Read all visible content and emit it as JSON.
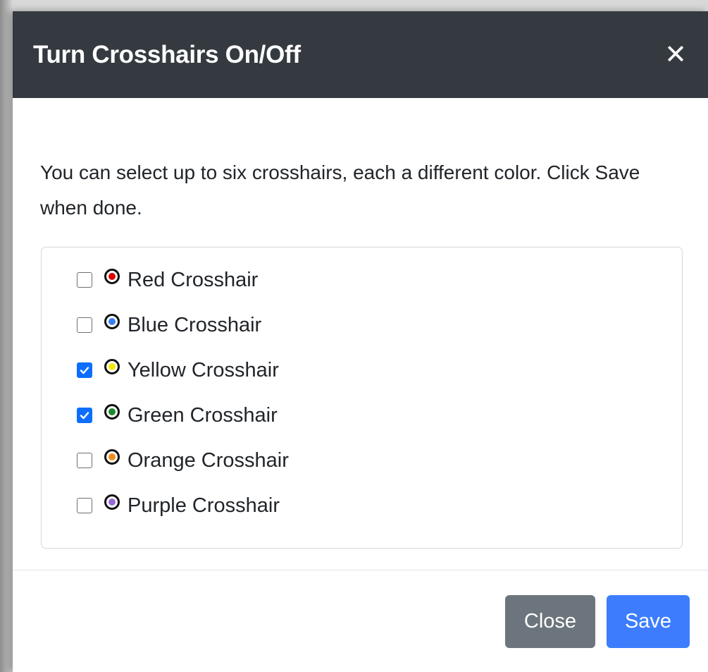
{
  "dialog": {
    "title": "Turn Crosshairs On/Off",
    "close_icon": "close-icon",
    "instructions": "You can select up to six crosshairs, each a different color. Click Save when done."
  },
  "options": [
    {
      "label": "Red Crosshair",
      "checked": false,
      "color": "#e00000"
    },
    {
      "label": "Blue Crosshair",
      "checked": false,
      "color": "#3a7ff0"
    },
    {
      "label": "Yellow Crosshair",
      "checked": true,
      "color": "#f5e800"
    },
    {
      "label": "Green Crosshair",
      "checked": true,
      "color": "#1a8a2a"
    },
    {
      "label": "Orange Crosshair",
      "checked": false,
      "color": "#f08c1a"
    },
    {
      "label": "Purple Crosshair",
      "checked": false,
      "color": "#9a6ad8"
    }
  ],
  "footer": {
    "close_label": "Close",
    "save_label": "Save"
  },
  "colors": {
    "header_bg": "#343a40",
    "close_button": "#6c757d",
    "save_button": "#3d7dfd",
    "checkbox_checked": "#0d6efd"
  }
}
